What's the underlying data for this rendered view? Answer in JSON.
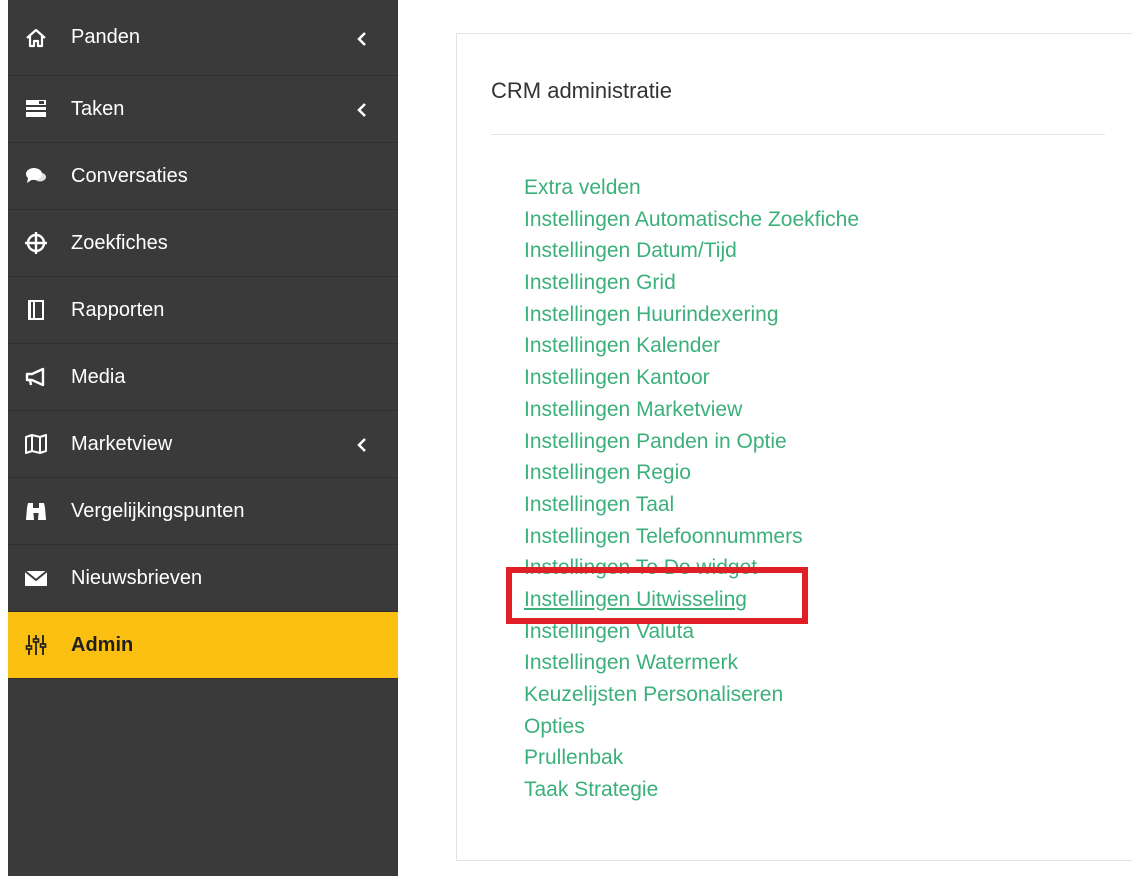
{
  "sidebar": {
    "items": [
      {
        "label": "Panden",
        "icon": "home-icon",
        "has_submenu": true
      },
      {
        "label": "Taken",
        "icon": "tasks-icon",
        "has_submenu": true
      },
      {
        "label": "Conversaties",
        "icon": "comments-icon",
        "has_submenu": false
      },
      {
        "label": "Zoekfiches",
        "icon": "crosshair-icon",
        "has_submenu": false
      },
      {
        "label": "Rapporten",
        "icon": "book-icon",
        "has_submenu": false
      },
      {
        "label": "Media",
        "icon": "megaphone-icon",
        "has_submenu": false
      },
      {
        "label": "Marketview",
        "icon": "map-icon",
        "has_submenu": true
      },
      {
        "label": "Vergelijkingspunten",
        "icon": "binoculars-icon",
        "has_submenu": false
      },
      {
        "label": "Nieuwsbrieven",
        "icon": "envelope-icon",
        "has_submenu": false
      },
      {
        "label": "Admin",
        "icon": "sliders-icon",
        "has_submenu": false,
        "active": true
      }
    ],
    "colors": {
      "background": "#3a3a3a",
      "active": "#fbbf12"
    }
  },
  "panel": {
    "title": "CRM administratie",
    "links": [
      "Extra velden",
      "Instellingen Automatische Zoekfiche",
      "Instellingen Datum/Tijd",
      "Instellingen Grid",
      "Instellingen Huurindexering",
      "Instellingen Kalender",
      "Instellingen Kantoor",
      "Instellingen Marketview",
      "Instellingen Panden in Optie",
      "Instellingen Regio",
      "Instellingen Taal",
      "Instellingen Telefoonnummers",
      "Instellingen To Do widget",
      "Instellingen Uitwisseling",
      "Instellingen Valuta",
      "Instellingen Watermerk",
      "Keuzelijsten Personaliseren",
      "Opties",
      "Prullenbak",
      "Taak Strategie"
    ],
    "highlighted_link": "Instellingen Uitwisseling",
    "link_color": "#3bb07a",
    "highlight_color": "#e01e26"
  }
}
